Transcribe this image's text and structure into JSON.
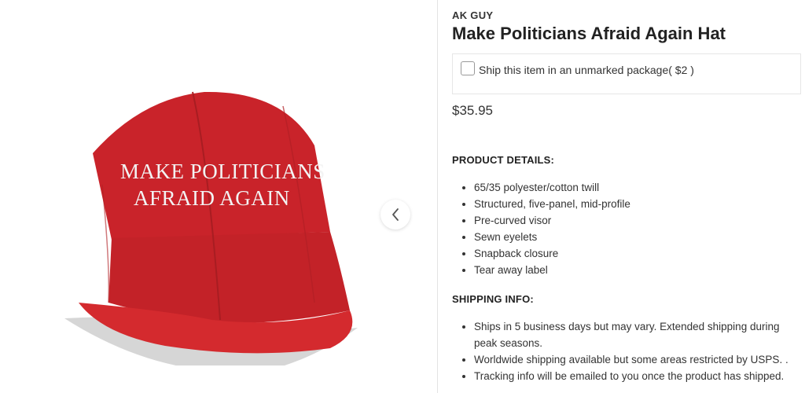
{
  "product": {
    "brand": "AK GUY",
    "title": "Make Politicians Afraid Again Hat",
    "image_text": [
      "MAKE POLITICIANS",
      "AFRAID AGAIN"
    ],
    "option_label": "Ship this item in an unmarked package( $2 )",
    "option_checked": false,
    "price": "$35.95"
  },
  "details": {
    "heading": "PRODUCT DETAILS:",
    "items": [
      "65/35 polyester/cotton twill",
      "Structured, five-panel, mid-profile",
      "Pre-curved visor",
      "Sewn eyelets",
      "Snapback closure",
      "Tear away label"
    ]
  },
  "shipping": {
    "heading": "SHIPPING INFO:",
    "items": [
      "Ships in 5 business days but may vary. Extended shipping during peak seasons.",
      "Worldwide shipping available but some areas restricted by USPS. .",
      "Tracking info will be emailed to you once the product has shipped."
    ]
  },
  "icons": {
    "carousel_prev": "chevron-left-icon",
    "edge_nav": "chevron-left-icon"
  },
  "colors": {
    "hat_red": "#d42a2e",
    "hat_shadow": "#a81d22"
  }
}
